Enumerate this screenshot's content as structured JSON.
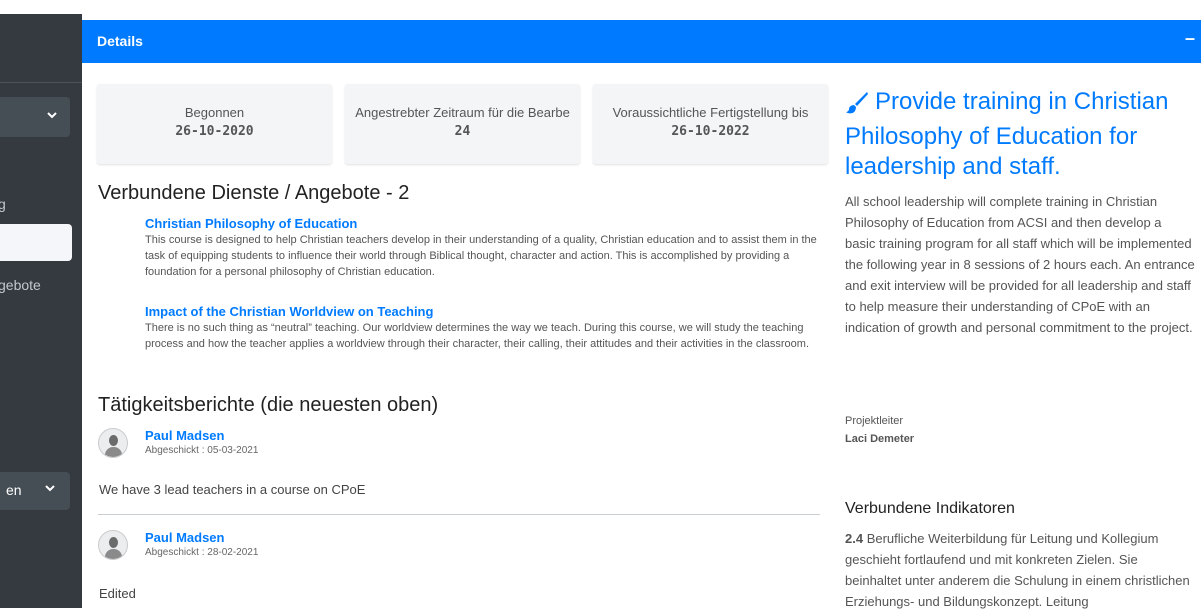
{
  "sidebar": {
    "items": [
      {
        "label": "g"
      },
      {
        "label": "gebote"
      }
    ],
    "bottom_select": {
      "label": "en"
    }
  },
  "header": {
    "title": "Details",
    "collapse_glyph": "–"
  },
  "info_boxes": [
    {
      "label": "Begonnen",
      "value": "26-10-2020"
    },
    {
      "label": "Angestrebter Zeitraum für die Bearbe",
      "value": "24"
    },
    {
      "label": "Voraussichtliche Fertigstellung bis",
      "value": "26-10-2022"
    }
  ],
  "services": {
    "heading": "Verbundene Dienste / Angebote - 2",
    "items": [
      {
        "title": "Christian Philosophy of Education",
        "description": "This course is designed to help Christian teachers develop in their understanding of a quality, Christian education and to assist them in the task of equipping students to influence their world through Biblical thought, character and action. This is accomplished by providing a foundation for a personal philosophy of Christian education."
      },
      {
        "title": "Impact of the Christian Worldview on Teaching",
        "description": "There is no such thing as “neutral” teaching. Our worldview determines the way we teach. During this course, we will study the teaching process and how the teacher applies a worldview through their character, their calling, their attitudes and their activities in the classroom."
      }
    ]
  },
  "reports": {
    "heading": "Tätigkeitsberichte (die neuesten oben)",
    "items": [
      {
        "author": "Paul Madsen",
        "sent": "Abgeschickt : 05-03-2021",
        "message": "We have 3 lead teachers in a course on CPoE"
      },
      {
        "author": "Paul Madsen",
        "sent": "Abgeschickt : 28-02-2021",
        "message": "Edited"
      }
    ]
  },
  "goal": {
    "title": "Provide training in Christian Philosophy of Education for leadership and staff.",
    "description": "All school leadership will complete training in Christian Philosophy of Education from ACSI and then develop a basic training program for all staff which will be implemented the following year in 8 sessions of 2 hours each. An entrance and exit interview will be provided for all leadership and staff to help measure their understanding of CPoE with an indication of growth and personal commitment to the project.",
    "leader_label": "Projektleiter",
    "leader_name": "Laci Demeter"
  },
  "indicators": {
    "heading": "Verbundene Indikatoren",
    "items": [
      {
        "number": "2.4",
        "text": "Berufliche Weiterbildung für Leitung und Kollegium geschieht fortlaufend und mit konkreten Zielen. Sie beinhaltet unter anderem die Schulung in einem christlichen Erziehungs- und Bildungskonzept. Leitung"
      }
    ]
  },
  "colors": {
    "primary": "#007bff",
    "sidebar": "#343a40"
  },
  "icons": [
    "chevron-down-icon",
    "paint-brush-icon",
    "avatar-icon",
    "minus-icon"
  ]
}
